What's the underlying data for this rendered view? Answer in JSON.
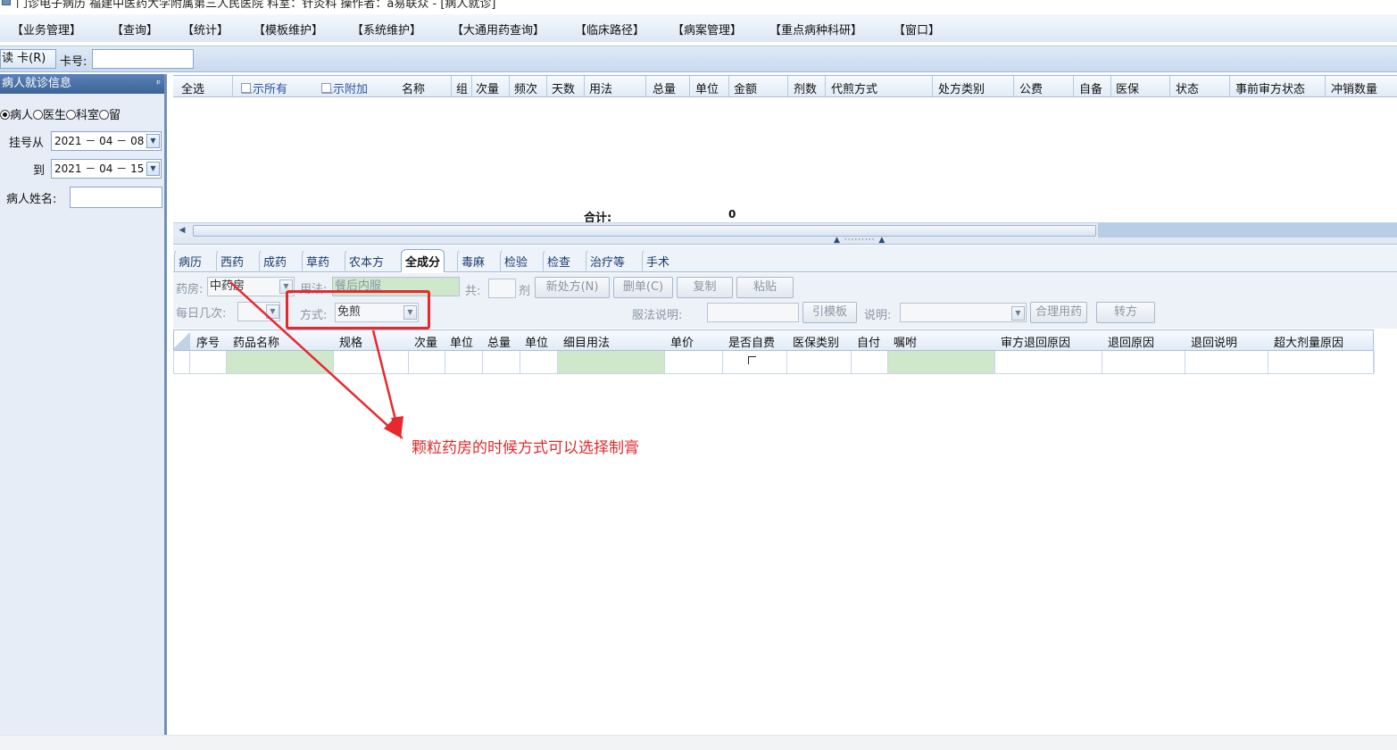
{
  "window": {
    "title": "门诊电子病历 福建中医药大学附属第三人民医院 科室：针灸科 操作者：a易联众 - [病人就诊]"
  },
  "menu": {
    "items": [
      "【业务管理】",
      "【查询】",
      "【统计】",
      "【模板维护】",
      "【系统维护】",
      "【大通用药查询】",
      "【临床路径】",
      "【病案管理】",
      "【重点病种科研】",
      "【窗口】"
    ]
  },
  "toolbar": {
    "read_card_label": "读 卡(R)",
    "card_no_label": "卡号:",
    "card_no_value": ""
  },
  "left_panel": {
    "header": "病人就诊信息",
    "pin_glyph": "ᵖ",
    "radios": [
      {
        "label": "病人",
        "selected": true
      },
      {
        "label": "医生",
        "selected": false
      },
      {
        "label": "科室",
        "selected": false
      },
      {
        "label": "留",
        "selected": false
      }
    ],
    "register_from_label": "挂号从",
    "register_from_value": "2021 － 04 － 08",
    "register_to_label": "到",
    "register_to_value": "2021 － 04 － 15",
    "patient_name_label": "病人姓名:",
    "patient_name_value": ""
  },
  "prescription_grid": {
    "select_all": "全选",
    "show_all": "显示所有",
    "show_extra": "显示附加",
    "columns": [
      "名称",
      "组",
      "次量",
      "频次",
      "天数",
      "用法",
      "总量",
      "单位",
      "金额",
      "剂数",
      "代煎方式",
      "处方类别",
      "公费",
      "自备",
      "医保",
      "状态",
      "事前审方状态",
      "冲销数量"
    ],
    "total_label": "合计:",
    "total_value": "0"
  },
  "tabs": [
    {
      "label": "病历",
      "active": false
    },
    {
      "label": "西药",
      "active": false
    },
    {
      "label": "成药",
      "active": false
    },
    {
      "label": "草药",
      "active": false
    },
    {
      "label": "农本方",
      "active": false
    },
    {
      "label": "全成分",
      "active": true
    },
    {
      "label": "毒麻",
      "active": false
    },
    {
      "label": "检验",
      "active": false
    },
    {
      "label": "检查",
      "active": false
    },
    {
      "label": "治疗等",
      "active": false
    },
    {
      "label": "手术",
      "active": false
    }
  ],
  "form": {
    "pharmacy_label": "药房:",
    "pharmacy_value": "中药房",
    "usage_label": "用法:",
    "usage_value": "餐后内服",
    "total_label": "共:",
    "total_value": "",
    "dose_unit": "剂",
    "new_rx_btn": "新处方(N)",
    "delete_btn": "删单(C)",
    "copy_btn": "复制",
    "paste_btn": "粘贴",
    "daily_times_label": "每日几次:",
    "daily_times_value": "",
    "method_label": "方式:",
    "method_value": "免煎",
    "dosage_note_label": "服法说明:",
    "dosage_note_value": "",
    "template_btn": "引模板",
    "note_label": "说明:",
    "note_value": "",
    "rational_btn": "合理用药",
    "transfer_btn": "转方"
  },
  "detail_grid": {
    "columns": [
      "序号",
      "药品名称",
      "规格",
      "次量",
      "单位",
      "总量",
      "单位",
      "细目用法",
      "单价",
      "是否自费",
      "医保类别",
      "自付",
      "嘱咐",
      "审方退回原因",
      "退回原因",
      "退回说明",
      "超大剂量原因"
    ]
  },
  "annotation": {
    "text": "颗粒药房的时候方式可以选择制膏",
    "color": "#e7282c"
  }
}
